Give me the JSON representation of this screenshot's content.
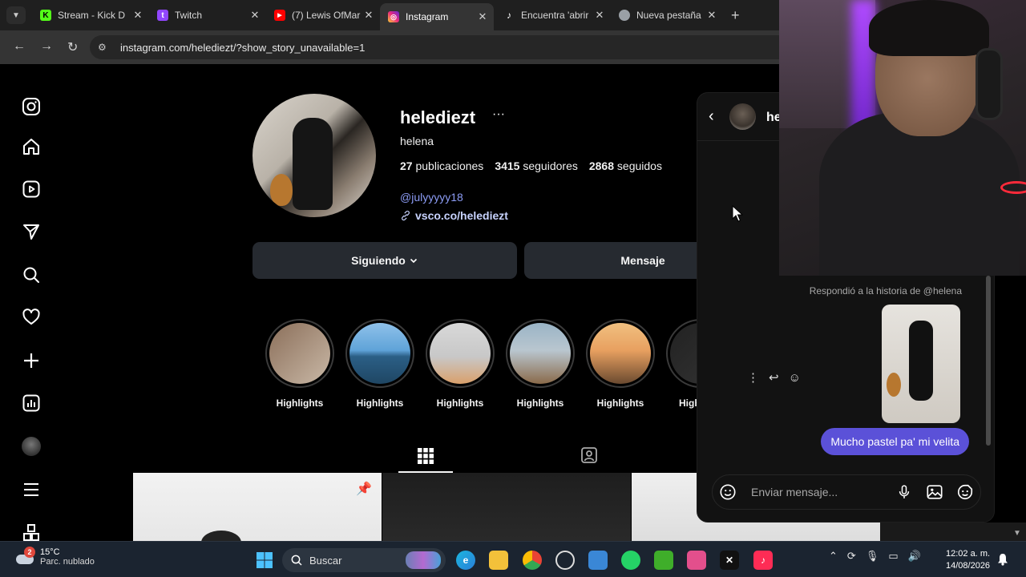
{
  "browser": {
    "tabs": [
      {
        "label": "Stream - Kick D",
        "icon": "kick-icon",
        "color": "#53fc18"
      },
      {
        "label": "Twitch",
        "icon": "twitch-icon",
        "color": "#9146ff"
      },
      {
        "label": "(7) Lewis OfMar",
        "icon": "youtube-icon",
        "color": "#ff0000"
      },
      {
        "label": "Instagram",
        "icon": "instagram-icon",
        "color": "#e1306c",
        "active": true
      },
      {
        "label": "Encuentra 'abrir",
        "icon": "tiktok-icon",
        "color": "#ffffff"
      },
      {
        "label": "Nueva pestaña",
        "icon": "chrome-icon",
        "color": "#9aa0a6"
      }
    ],
    "url": "instagram.com/helediezt/?show_story_unavailable=1"
  },
  "profile": {
    "username": "helediezt",
    "more": "···",
    "full_name": "helena",
    "posts_count": "27",
    "posts_label": "publicaciones",
    "followers_count": "3415",
    "followers_label": "seguidores",
    "following_count": "2868",
    "following_label": "seguidos",
    "mention": "@julyyyyy18",
    "link": "vsco.co/helediezt",
    "following_button": "Siguiendo",
    "message_button": "Mensaje"
  },
  "highlights": [
    {
      "label": "Highlights",
      "colors": [
        "#8b6f5a",
        "#c9b8a6"
      ]
    },
    {
      "label": "Highlights",
      "colors": [
        "#5fa3d8",
        "#2b5f86"
      ]
    },
    {
      "label": "Highlights",
      "colors": [
        "#c8c8c8",
        "#d9a06b"
      ]
    },
    {
      "label": "Highlights",
      "colors": [
        "#9ab4c6",
        "#8a6a4a"
      ]
    },
    {
      "label": "Highlights",
      "colors": [
        "#e8a060",
        "#6a4a30"
      ]
    },
    {
      "label": "High",
      "colors": [
        "#222222",
        "#333333"
      ]
    }
  ],
  "dm": {
    "name": "he",
    "reply_note": "Respondió a la historia de @helena",
    "message": "Mucho pastel pa' mi velita",
    "input_placeholder": "Enviar mensaje..."
  },
  "taskbar": {
    "temperature": "15°C",
    "weather": "Parc. nublado",
    "weather_badge": "2",
    "search": "Buscar",
    "time": "12:02 a. m.",
    "date": "14/08/2026"
  }
}
